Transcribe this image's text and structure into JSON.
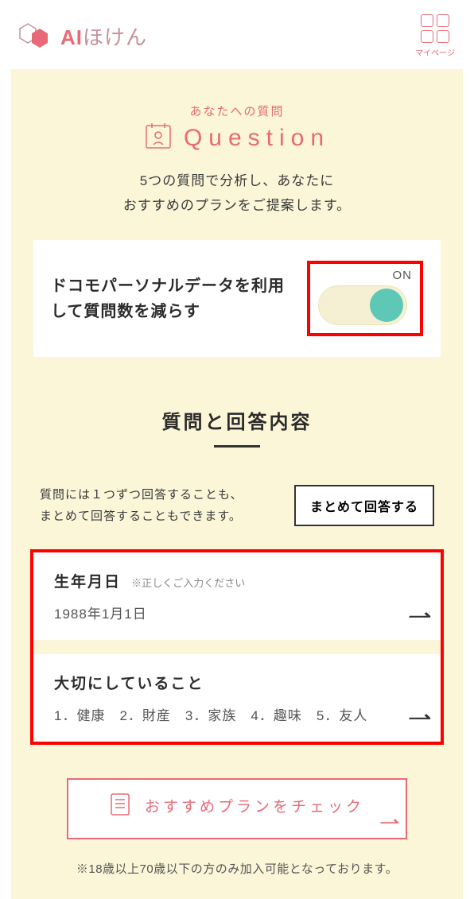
{
  "header": {
    "logo_prefix": "AI",
    "logo_suffix": "ほけん",
    "mypage_label": "マイページ"
  },
  "question_block": {
    "mini_title": "あなたへの質問",
    "big_title": "Question",
    "subtitle_line1": "5つの質問で分析し、あなたに",
    "subtitle_line2": "おすすめのプランをご提案します。"
  },
  "toggle": {
    "label": "ドコモパーソナルデータを利用して質問数を減らす",
    "state_label": "ON",
    "on": true
  },
  "answers_section": {
    "title": "質問と回答内容",
    "intro_line1": "質問には１つずつ回答することも、",
    "intro_line2": "まとめて回答することもできます。",
    "batch_button": "まとめて回答する",
    "items": [
      {
        "title": "生年月日",
        "note": "※正しくご入力ください",
        "value": "1988年1月1日"
      },
      {
        "title": "大切にしていること",
        "note": "",
        "value": "1．健康　2．財産　3．家族　4．趣味　5．友人"
      }
    ]
  },
  "cta": {
    "label": "おすすめプランをチェック"
  },
  "footnote": "※18歳以上70歳以下の方のみ加入可能となっております。",
  "colors": {
    "accent": "#e76a77",
    "bg_cream": "#fbf6d8",
    "toggle_knob": "#5fc7b6",
    "highlight_border": "#ff0000"
  }
}
